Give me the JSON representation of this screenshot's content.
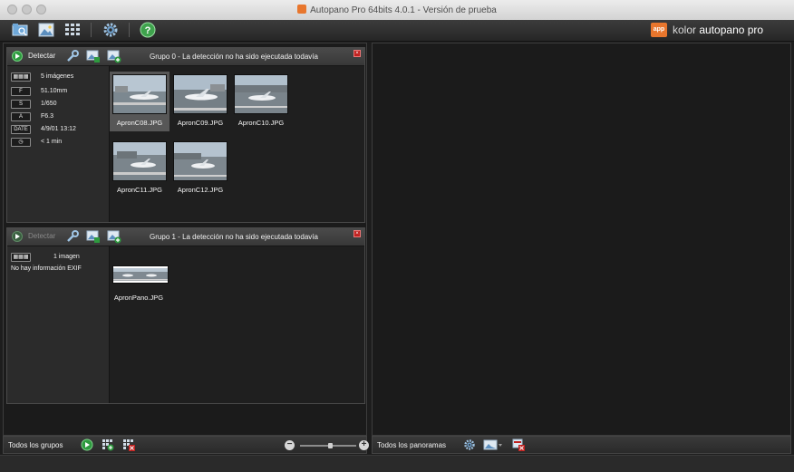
{
  "window": {
    "title": "Autopano Pro 64bits 4.0.1 - Versión de prueba",
    "app_badge": "app"
  },
  "brand": {
    "badge": "app",
    "company": "kolor",
    "product": "autopano pro"
  },
  "toolbar": {
    "icons": [
      "open-folder-icon",
      "add-images-icon",
      "batch-grid-icon",
      "settings-gear-icon",
      "help-icon"
    ]
  },
  "groups": [
    {
      "detect_label": "Detectar",
      "detect_enabled": true,
      "title": "Grupo 0 - La detección no ha sido ejecutada todavía",
      "info": [
        {
          "key": "▦▦▦",
          "value": "5 imágenes"
        },
        {
          "key": "F",
          "value": "51.10mm"
        },
        {
          "key": "S",
          "value": "1/650"
        },
        {
          "key": "A",
          "value": "F6.3"
        },
        {
          "key": "DATE",
          "value": "4/9/01 13:12"
        },
        {
          "key": "◷",
          "value": "< 1 min"
        }
      ],
      "images": [
        {
          "name": "ApronC08.JPG",
          "selected": true
        },
        {
          "name": "ApronC09.JPG",
          "selected": false
        },
        {
          "name": "ApronC10.JPG",
          "selected": false
        },
        {
          "name": "ApronC11.JPG",
          "selected": false
        },
        {
          "name": "ApronC12.JPG",
          "selected": false
        }
      ]
    },
    {
      "detect_label": "Detectar",
      "detect_enabled": false,
      "title": "Grupo 1 - La detección no ha sido ejecutada todavía",
      "info": [
        {
          "key": "▦▦▦",
          "value": "1 imagen"
        }
      ],
      "no_exif": "No hay información EXIF",
      "images": [
        {
          "name": "ApronPano.JPG",
          "selected": false
        }
      ]
    }
  ],
  "left_bottom": {
    "label": "Todos los grupos",
    "zoom_level": 0.55
  },
  "right_bottom": {
    "label": "Todos los panoramas"
  },
  "colors": {
    "accent": "#e8762d",
    "play": "#2e9a3f",
    "close": "#c0211f"
  }
}
